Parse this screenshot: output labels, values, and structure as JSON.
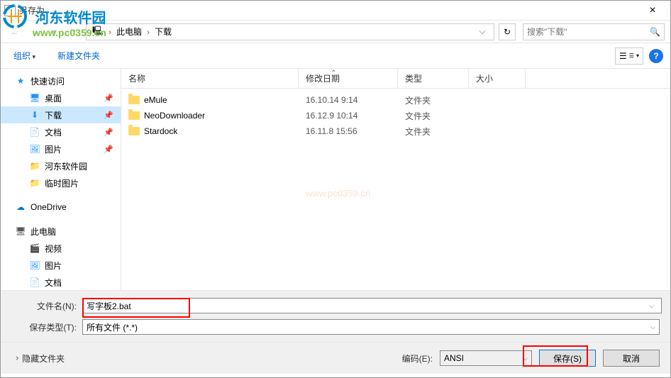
{
  "titlebar": {
    "title": "另存为"
  },
  "watermark": {
    "cn": "河东软件园",
    "url": "www.pc0359.cn"
  },
  "breadcrumb": {
    "seg1": "此电脑",
    "seg2": "下载"
  },
  "search": {
    "placeholder": "搜索\"下载\""
  },
  "toolbar": {
    "organize": "组织",
    "newfolder": "新建文件夹"
  },
  "sidebar": {
    "quick": "快速访问",
    "desktop": "桌面",
    "downloads": "下载",
    "documents": "文档",
    "pictures": "图片",
    "hedong": "河东软件园",
    "temppics": "临时图片",
    "onedrive": "OneDrive",
    "thispc": "此电脑",
    "video": "视频",
    "pics2": "图片",
    "docs2": "文档"
  },
  "columns": {
    "name": "名称",
    "date": "修改日期",
    "type": "类型",
    "size": "大小"
  },
  "files": [
    {
      "name": "eMule",
      "date": "16.10.14 9:14",
      "type": "文件夹"
    },
    {
      "name": "NeoDownloader",
      "date": "16.12.9 10:14",
      "type": "文件夹"
    },
    {
      "name": "Stardock",
      "date": "16.11.8 15:56",
      "type": "文件夹"
    }
  ],
  "inputs": {
    "filename_label": "文件名(N):",
    "filename_value": "写字板2.bat",
    "filetype_label": "保存类型(T):",
    "filetype_value": "所有文件 (*.*)"
  },
  "footer": {
    "hide_folders": "隐藏文件夹",
    "encoding_label": "编码(E):",
    "encoding_value": "ANSI",
    "save": "保存(S)",
    "cancel": "取消"
  }
}
